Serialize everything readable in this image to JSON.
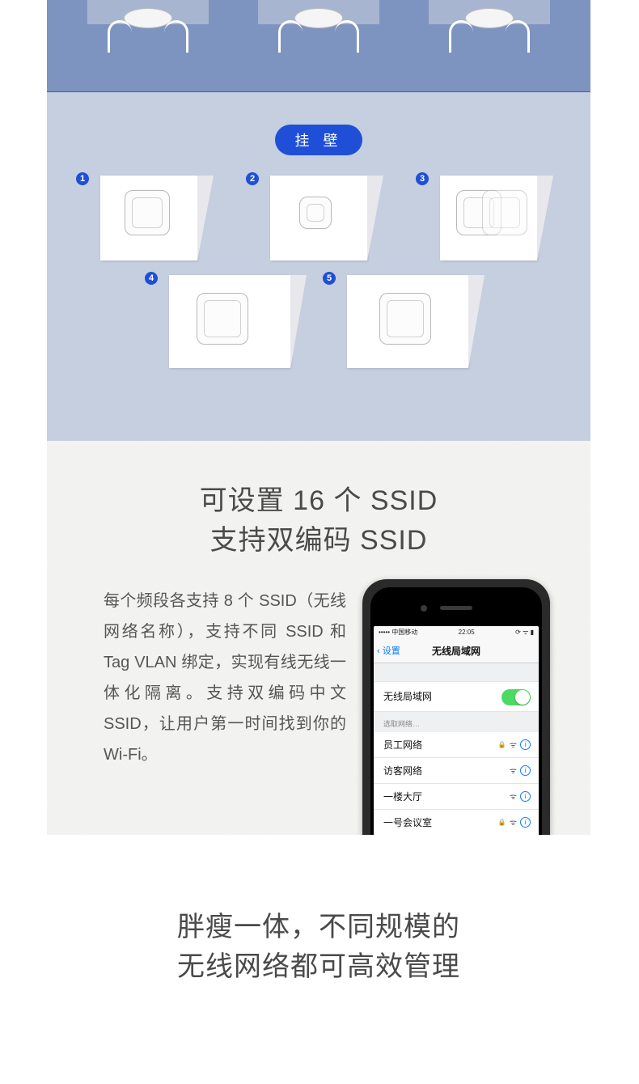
{
  "wall_mount": {
    "pill_label": "挂 壁",
    "steps": [
      "1",
      "2",
      "3",
      "4",
      "5"
    ]
  },
  "ssid": {
    "title_line1": "可设置 16 个 SSID",
    "title_line2": "支持双编码 SSID",
    "description": "每个频段各支持 8 个 SSID（无线网络名称），支持不同 SSID 和 Tag VLAN 绑定，实现有线无线一体化隔离。支持双编码中文 SSID，让用户第一时间找到你的Wi-Fi。"
  },
  "phone": {
    "carrier": "中国移动",
    "time": "22:05",
    "back_label": "设置",
    "nav_title": "无线局域网",
    "toggle_row": "无线局域网",
    "section_label": "选取网络…",
    "networks": [
      {
        "name": "员工网络",
        "locked": true
      },
      {
        "name": "访客网络",
        "locked": false
      },
      {
        "name": "一楼大厅",
        "locked": false
      },
      {
        "name": "一号会议室",
        "locked": true
      }
    ]
  },
  "bottom": {
    "line1": "胖瘦一体，不同规模的",
    "line2": "无线网络都可高效管理"
  }
}
